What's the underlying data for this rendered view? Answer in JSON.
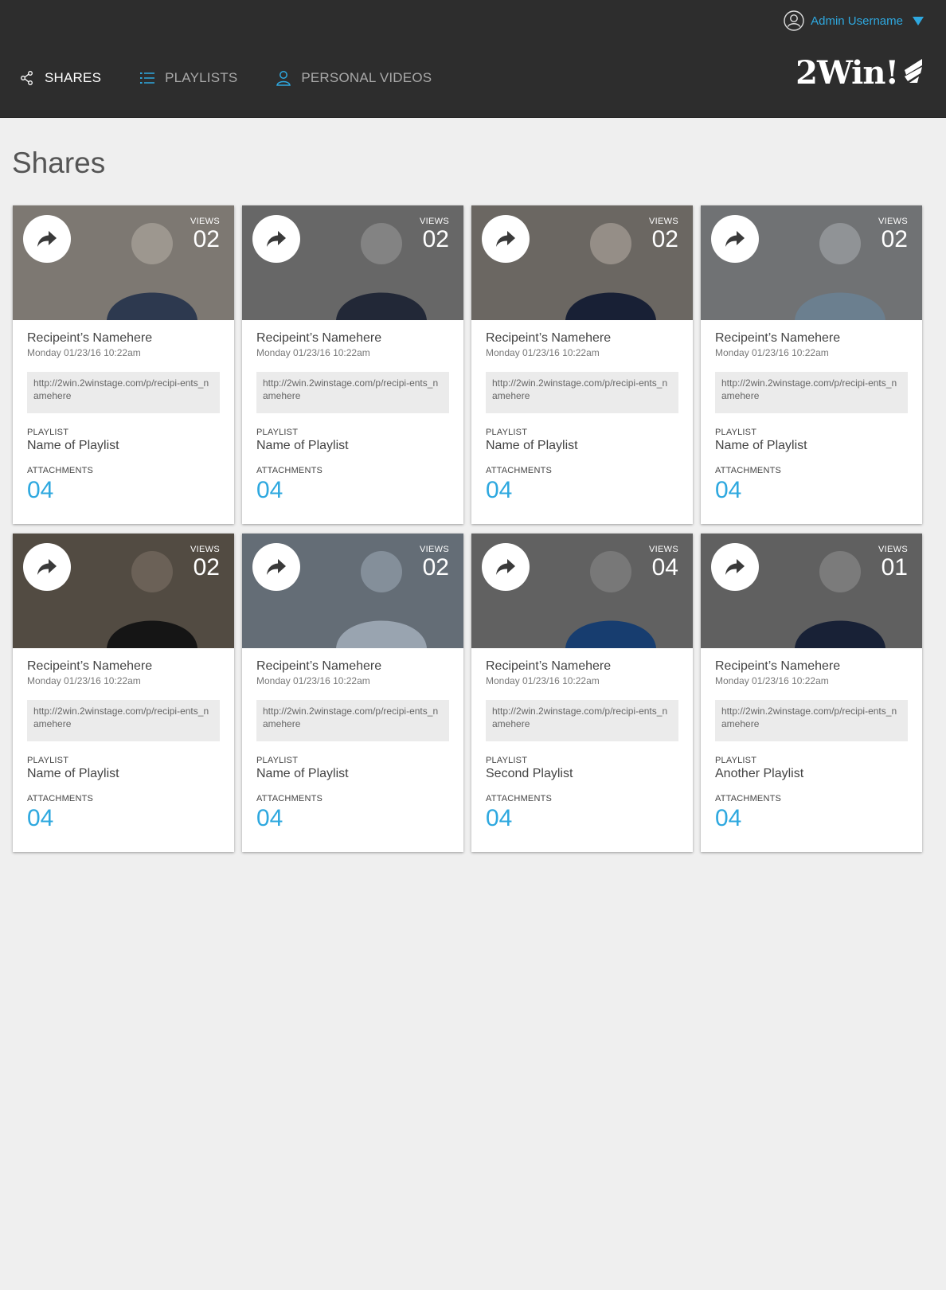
{
  "header": {
    "user_name": "Admin Username",
    "user_icon": "user-circle-icon",
    "logo_text": "2Win!",
    "nav": [
      {
        "label": "SHARES",
        "icon": "share-icon",
        "active": true
      },
      {
        "label": "PLAYLISTS",
        "icon": "list-icon",
        "active": false
      },
      {
        "label": "PERSONAL VIDEOS",
        "icon": "person-icon",
        "active": false
      }
    ]
  },
  "page": {
    "title": "Shares"
  },
  "colors": {
    "accent": "#2ea8df",
    "topbar": "#2d2d2d",
    "background": "#efefef"
  },
  "cards": [
    {
      "views_label": "VIEWS",
      "views": "02",
      "recipient": "Recipeint’s Namehere",
      "date": "Monday 01/23/16 10:22am",
      "link": "http://2win.2winstage.com/p/recipi-ents_namehere",
      "playlist_label": "PLAYLIST",
      "playlist": "Name of Playlist",
      "attachments_label": "ATTACHMENTS",
      "attachments": "04"
    },
    {
      "views_label": "VIEWS",
      "views": "02",
      "recipient": "Recipeint’s Namehere",
      "date": "Monday 01/23/16 10:22am",
      "link": "http://2win.2winstage.com/p/recipi-ents_namehere",
      "playlist_label": "PLAYLIST",
      "playlist": "Name of Playlist",
      "attachments_label": "ATTACHMENTS",
      "attachments": "04"
    },
    {
      "views_label": "VIEWS",
      "views": "02",
      "recipient": "Recipeint’s Namehere",
      "date": "Monday 01/23/16 10:22am",
      "link": "http://2win.2winstage.com/p/recipi-ents_namehere",
      "playlist_label": "PLAYLIST",
      "playlist": "Name of Playlist",
      "attachments_label": "ATTACHMENTS",
      "attachments": "04"
    },
    {
      "views_label": "VIEWS",
      "views": "02",
      "recipient": "Recipeint’s Namehere",
      "date": "Monday 01/23/16 10:22am",
      "link": "http://2win.2winstage.com/p/recipi-ents_namehere",
      "playlist_label": "PLAYLIST",
      "playlist": "Name of Playlist",
      "attachments_label": "ATTACHMENTS",
      "attachments": "04"
    },
    {
      "views_label": "VIEWS",
      "views": "02",
      "recipient": "Recipeint’s Namehere",
      "date": "Monday 01/23/16 10:22am",
      "link": "http://2win.2winstage.com/p/recipi-ents_namehere",
      "playlist_label": "PLAYLIST",
      "playlist": "Name of Playlist",
      "attachments_label": "ATTACHMENTS",
      "attachments": "04"
    },
    {
      "views_label": "VIEWS",
      "views": "02",
      "recipient": "Recipeint’s Namehere",
      "date": "Monday 01/23/16 10:22am",
      "link": "http://2win.2winstage.com/p/recipi-ents_namehere",
      "playlist_label": "PLAYLIST",
      "playlist": "Name of Playlist",
      "attachments_label": "ATTACHMENTS",
      "attachments": "04"
    },
    {
      "views_label": "VIEWS",
      "views": "04",
      "recipient": "Recipeint’s Namehere",
      "date": "Monday 01/23/16 10:22am",
      "link": "http://2win.2winstage.com/p/recipi-ents_namehere",
      "playlist_label": "PLAYLIST",
      "playlist": "Second Playlist",
      "attachments_label": "ATTACHMENTS",
      "attachments": "04"
    },
    {
      "views_label": "VIEWS",
      "views": "01",
      "recipient": "Recipeint’s Namehere",
      "date": "Monday 01/23/16 10:22am",
      "link": "http://2win.2winstage.com/p/recipi-ents_namehere",
      "playlist_label": "PLAYLIST",
      "playlist": "Another Playlist",
      "attachments_label": "ATTACHMENTS",
      "attachments": "04"
    }
  ]
}
